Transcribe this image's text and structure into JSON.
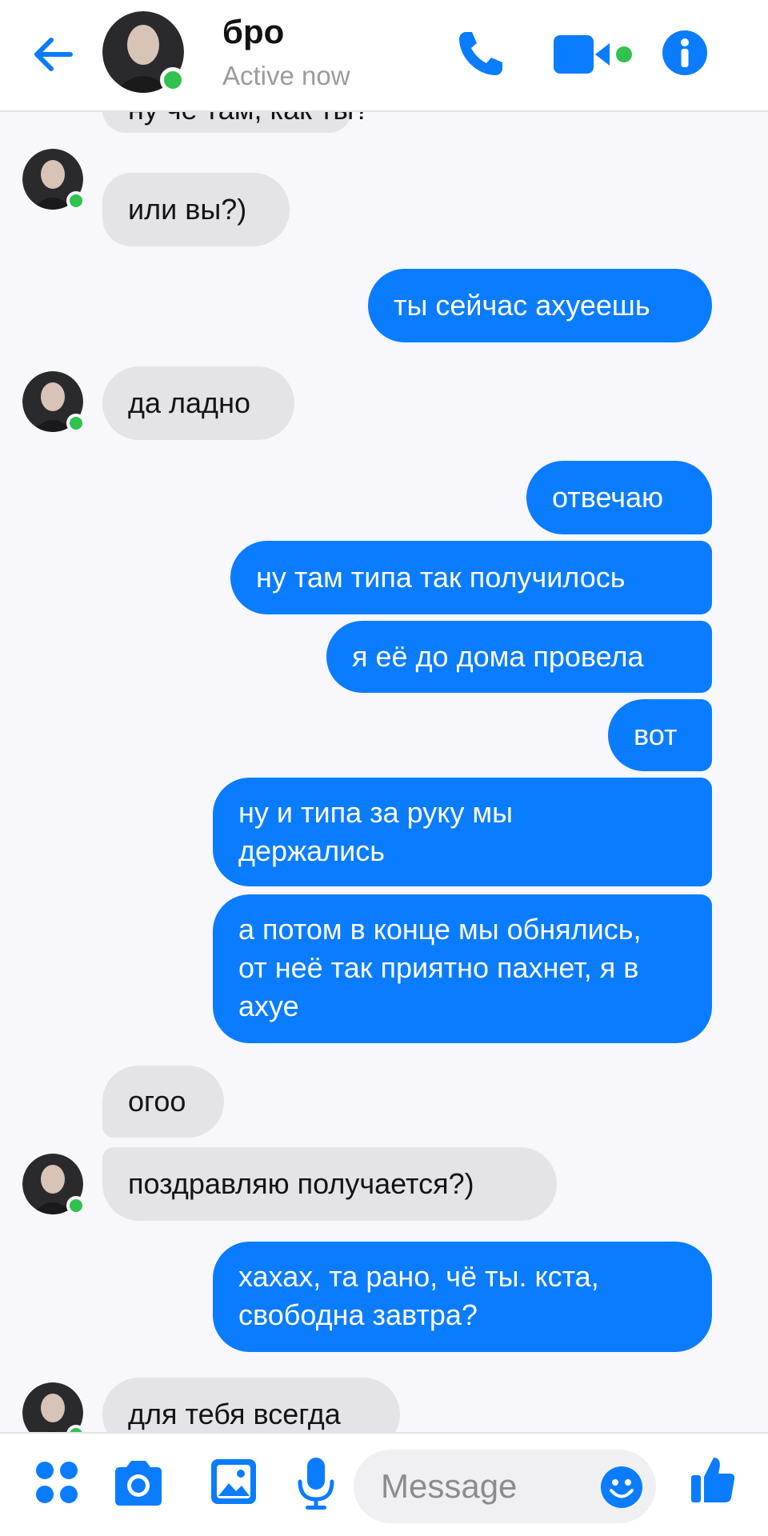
{
  "header": {
    "name": "бро",
    "status": "Active now"
  },
  "messages": [
    {
      "side": "in",
      "text": "ну чё там, как ты?",
      "avatar": false
    },
    {
      "side": "in",
      "text": "или вы?)",
      "avatar": true
    },
    {
      "side": "out",
      "text": "ты сейчас ахуеешь"
    },
    {
      "side": "in",
      "text": "да ладно",
      "avatar": true
    },
    {
      "side": "out",
      "text": "отвечаю"
    },
    {
      "side": "out",
      "text": "ну там типа так получилось"
    },
    {
      "side": "out",
      "text": "я её до дома провела"
    },
    {
      "side": "out",
      "text": "вот"
    },
    {
      "side": "out",
      "text": "ну и типа за руку мы держались"
    },
    {
      "side": "out",
      "text": "а потом в конце мы обнялись, от неё так приятно пахнет, я в ахуе"
    },
    {
      "side": "in",
      "text": "огоо",
      "avatar": false
    },
    {
      "side": "in",
      "text": "поздравляю получается?)",
      "avatar": true
    },
    {
      "side": "out",
      "text": "хахах, та рано, чё ты. кста, свободна завтра?"
    },
    {
      "side": "in",
      "text": "для тебя всегда",
      "avatar": true
    }
  ],
  "composer": {
    "placeholder": "Message"
  },
  "icons": {
    "back": "arrow-left-icon",
    "call": "phone-icon",
    "video": "video-camera-icon",
    "info": "info-icon",
    "menu": "four-dots-icon",
    "camera": "camera-icon",
    "gallery": "image-icon",
    "mic": "microphone-icon",
    "emoji": "smiley-icon",
    "like": "thumbs-up-icon"
  },
  "colors": {
    "accent": "#0a7cff",
    "incoming_bubble": "#e4e4e8",
    "online": "#31c24d",
    "background": "#f8f7fb"
  }
}
